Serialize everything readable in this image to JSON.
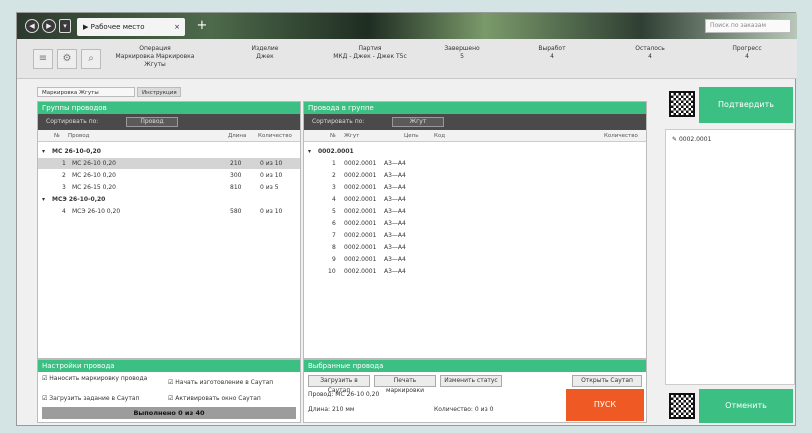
{
  "titlebar": {
    "tab_label": "Рабочее место",
    "tab_close": "×",
    "new_tab": "+",
    "search_placeholder": "Поиск по заказам"
  },
  "toolbar": {
    "info": [
      {
        "label": "Операция",
        "value": "Маркировка Маркировка Жгуты"
      },
      {
        "label": "Изделие",
        "value": "Джек"
      },
      {
        "label": "Партия",
        "value": "МКД - Джек - Джек Т5с"
      },
      {
        "label": "Завершено",
        "value": "5"
      },
      {
        "label": "Выработ",
        "value": "4"
      },
      {
        "label": "Осталось",
        "value": "4"
      },
      {
        "label": "Прогресс",
        "value": "4"
      }
    ]
  },
  "subtabs": {
    "active": "Маркировка Жгуты",
    "inactive": "Инструкция"
  },
  "left_panel": {
    "title": "Группы проводов",
    "sort_label": "Сортировать по:",
    "sort_value": "Провод",
    "columns": [
      "№",
      "Провод",
      "Длина",
      "Количество"
    ],
    "groups": [
      {
        "name": "МС 26-10-0,20",
        "rows": [
          {
            "num": "1",
            "wire": "МС 26-10 0,20",
            "length": "210",
            "qty": "0 из 10"
          },
          {
            "num": "2",
            "wire": "МС 26-10 0,20",
            "length": "300",
            "qty": "0 из 10"
          },
          {
            "num": "3",
            "wire": "МС 26-15 0,20",
            "length": "810",
            "qty": "0 из 5"
          }
        ]
      },
      {
        "name": "МСЭ 26-10-0,20",
        "rows": [
          {
            "num": "4",
            "wire": "МСЭ 26-10 0,20",
            "length": "580",
            "qty": "0 из 10"
          }
        ]
      }
    ]
  },
  "right_panel": {
    "title": "Провода в группе",
    "sort_label": "Сортировать по:",
    "sort_value": "Жгут",
    "columns": [
      "№",
      "Жгут",
      "Цепь",
      "Код",
      "Количество"
    ],
    "group_name": "0002.0001",
    "rows": [
      {
        "num": "1",
        "harness": "0002.0001",
        "chain": "А3—А4"
      },
      {
        "num": "2",
        "harness": "0002.0001",
        "chain": "А3—А4"
      },
      {
        "num": "3",
        "harness": "0002.0001",
        "chain": "А3—А4"
      },
      {
        "num": "4",
        "harness": "0002.0001",
        "chain": "А3—А4"
      },
      {
        "num": "5",
        "harness": "0002.0001",
        "chain": "А3—А4"
      },
      {
        "num": "6",
        "harness": "0002.0001",
        "chain": "А3—А4"
      },
      {
        "num": "7",
        "harness": "0002.0001",
        "chain": "А3—А4"
      },
      {
        "num": "8",
        "harness": "0002.0001",
        "chain": "А3—А4"
      },
      {
        "num": "9",
        "harness": "0002.0001",
        "chain": "А3—А4"
      },
      {
        "num": "10",
        "harness": "0002.0001",
        "chain": "А3—А4"
      }
    ]
  },
  "settings": {
    "title": "Настройки провода",
    "check1": "Наносить маркировку провода",
    "check2": "Начать изготовление в Саутап",
    "check3": "Загрузить задание в Саутап",
    "check4": "Активировать окно Саутап",
    "progress_label": "Выполнено 0 из 40"
  },
  "selected": {
    "title": "Выбранные провода",
    "btn1": "Загрузить в Саутап",
    "btn2": "Печать маркировки",
    "btn3": "Изменить статус",
    "btn4": "Открыть Саутап",
    "wire_label": "Провод:",
    "wire_value": "МС 26-10 0,20",
    "length_label": "Длина:",
    "length_value": "210 мм",
    "qty_label": "Количество:",
    "qty_value": "0 из 0",
    "start_label": "ПУСК"
  },
  "side": {
    "top_btn": "Подтвердить",
    "list_item": "0002.0001",
    "bottom_btn": "Отменить"
  },
  "colors": {
    "accent_green": "#3cbf83",
    "start_orange": "#ef5a24",
    "dark_bar": "#4a4a4a"
  }
}
